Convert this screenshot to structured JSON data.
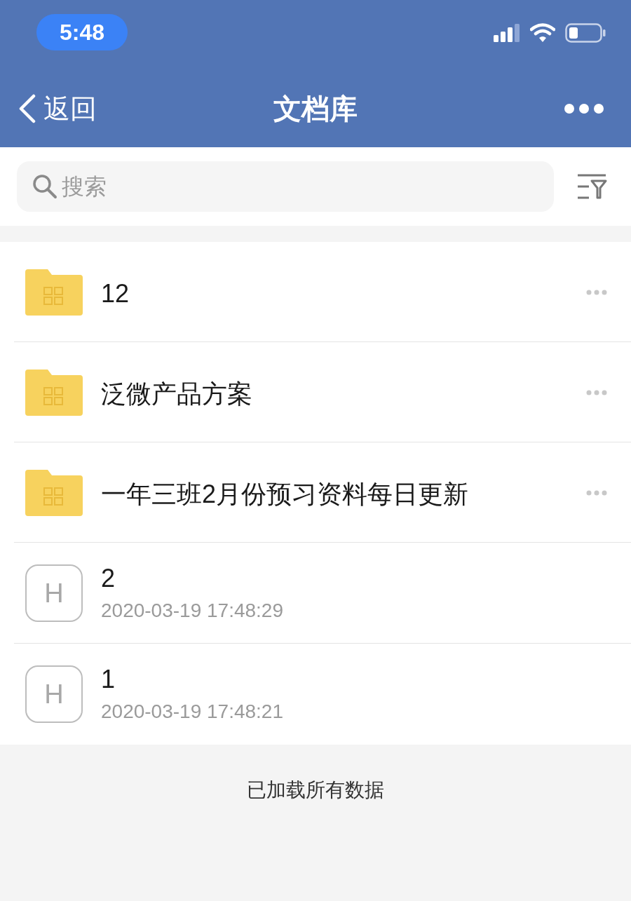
{
  "status_bar": {
    "time": "5:48"
  },
  "nav_bar": {
    "back_label": "返回",
    "title": "文档库"
  },
  "search": {
    "placeholder": "搜索"
  },
  "items": [
    {
      "kind": "folder",
      "name": "12"
    },
    {
      "kind": "folder",
      "name": "泛微产品方案"
    },
    {
      "kind": "folder",
      "name": "一年三班2月份预习资料每日更新"
    },
    {
      "kind": "file",
      "name": "2",
      "badge": "H",
      "date": "2020-03-19 17:48:29"
    },
    {
      "kind": "file",
      "name": "1",
      "badge": "H",
      "date": "2020-03-19 17:48:21"
    }
  ],
  "footer": "已加载所有数据"
}
